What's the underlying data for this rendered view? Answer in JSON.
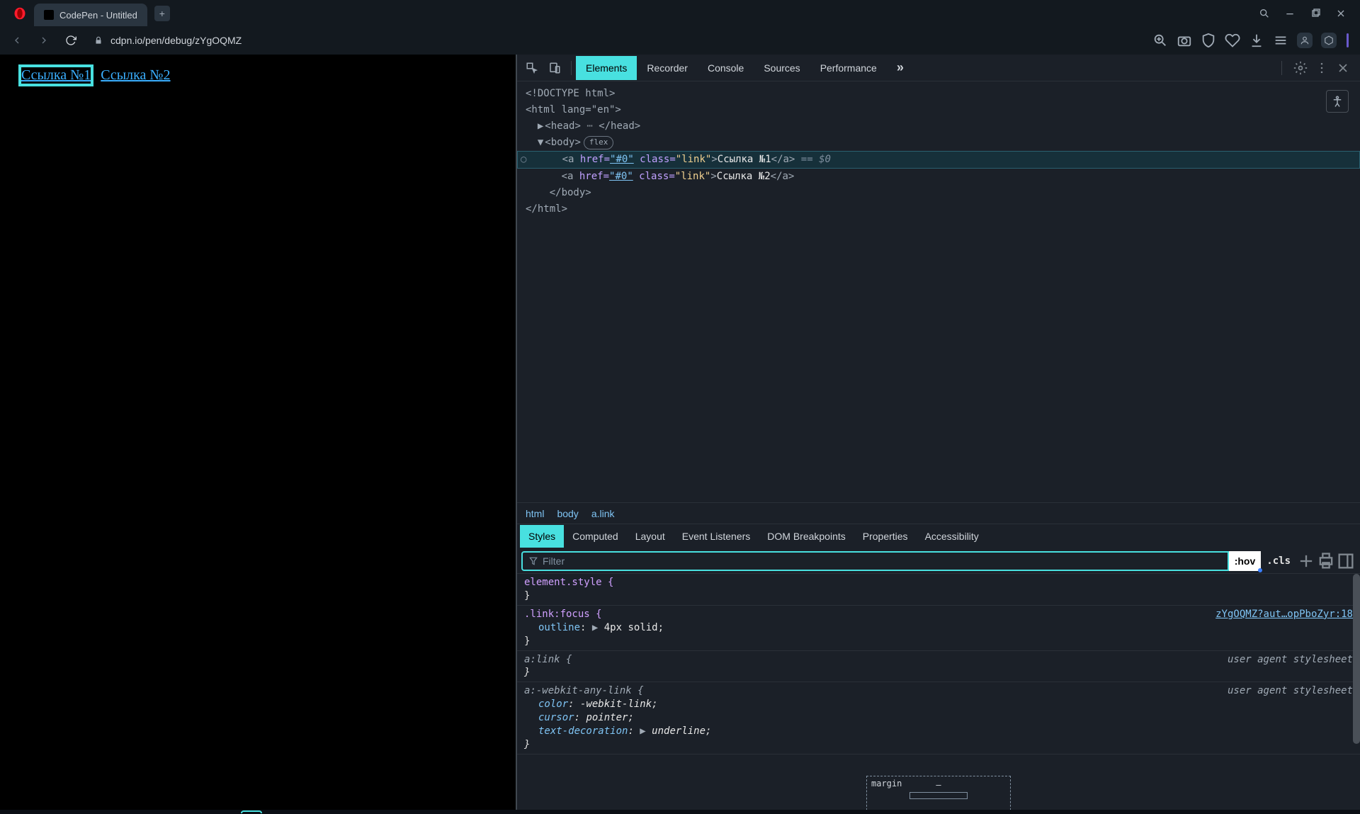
{
  "titlebar": {
    "tab_title": "CodePen - Untitled"
  },
  "addressbar": {
    "url": "cdpn.io/pen/debug/zYgOQMZ"
  },
  "page": {
    "link1": "Ссылка №1",
    "link2": "Ссылка №2"
  },
  "devtools": {
    "tabs": {
      "elements": "Elements",
      "recorder": "Recorder",
      "console": "Console",
      "sources": "Sources",
      "performance": "Performance"
    },
    "dom": {
      "doctype": "<!DOCTYPE html>",
      "html_open": "<html lang=\"en\">",
      "head": {
        "open": "<head>",
        "close": "</head>"
      },
      "body": {
        "open": "<body>",
        "badge": "flex",
        "close": "</body>"
      },
      "a1": {
        "tag_open": "<a ",
        "href_attr": "href=",
        "href_val": "\"#0\"",
        "class_attr": " class=",
        "class_val": "\"link\"",
        "gt": ">",
        "text": "Ссылка №1",
        "close": "</a>",
        "eq": " == $0"
      },
      "a2": {
        "tag_open": "<a ",
        "href_attr": "href=",
        "href_val": "\"#0\"",
        "class_attr": " class=",
        "class_val": "\"link\"",
        "gt": ">",
        "text": "Ссылка №2",
        "close": "</a>"
      },
      "html_close": "</html>"
    },
    "breadcrumb": {
      "html": "html",
      "body": "body",
      "alink": "a.link"
    },
    "styles_tabs": {
      "styles": "Styles",
      "computed": "Computed",
      "layout": "Layout",
      "event_listeners": "Event Listeners",
      "dom_breakpoints": "DOM Breakpoints",
      "properties": "Properties",
      "accessibility": "Accessibility"
    },
    "filter": {
      "placeholder": "Filter",
      "hov": ":hov",
      "cls": ".cls"
    },
    "rules": {
      "r1": {
        "selector": "element.style {",
        "close": "}"
      },
      "r2": {
        "selector": ".link:focus {",
        "source": "zYgOQMZ?aut…opPboZyr:18",
        "prop1": "outline",
        "val1": "4px solid",
        "close": "}"
      },
      "r3": {
        "selector": "a:link {",
        "source": "user agent stylesheet",
        "close": "}"
      },
      "r4": {
        "selector": "a:-webkit-any-link {",
        "source": "user agent stylesheet",
        "prop1": "color",
        "val1": "-webkit-link",
        "prop2": "cursor",
        "val2": "pointer",
        "prop3": "text-decoration",
        "val3": "underline",
        "close": "}"
      }
    },
    "boxmodel": {
      "margin": "margin",
      "dash": "–"
    }
  }
}
